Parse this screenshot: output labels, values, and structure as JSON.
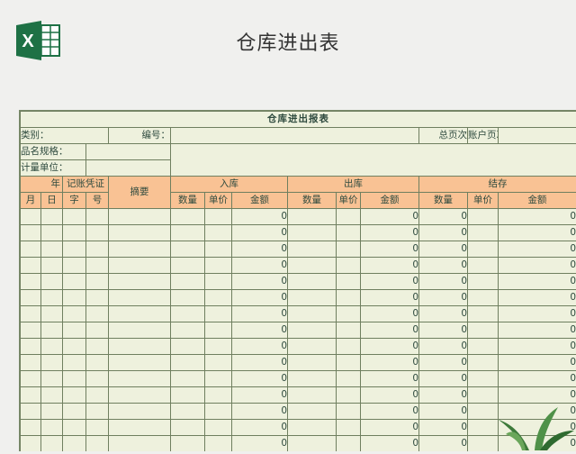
{
  "page": {
    "heading": "仓库进出表",
    "app_icon": "excel-icon",
    "app_icon_letter": "X"
  },
  "sheet": {
    "title": "仓库进出报表",
    "info": {
      "category_label": "类别：",
      "code_label": "编号：",
      "total_pages_label": "总页次",
      "account_pages_label": "账户页次",
      "spec_label": "品名规格：",
      "unit_label": "计量单位："
    },
    "headers": {
      "year": "年",
      "voucher": "记账凭证",
      "summary": "摘要",
      "in": "入库",
      "out": "出库",
      "balance": "结存",
      "month": "月",
      "day": "日",
      "word": "字",
      "number": "号",
      "qty": "数量",
      "unit_price": "单价",
      "amount": "金额"
    },
    "zero": "0",
    "row_count": 15
  },
  "colors": {
    "header_fill": "#f9c294",
    "sheet_bg": "#eef1dd",
    "title_color": "#1f4e5a",
    "excel_green": "#1e7145"
  }
}
